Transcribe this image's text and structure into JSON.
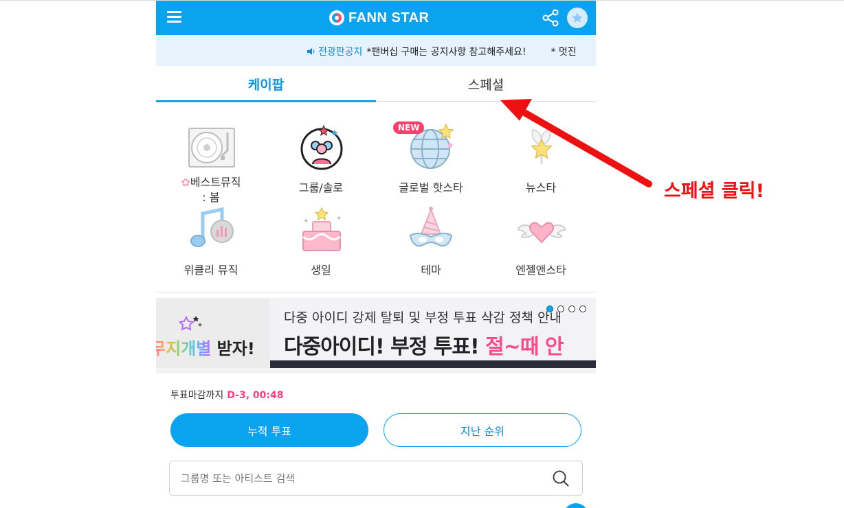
{
  "header": {
    "logo_text": "FANN STAR",
    "brand_color": "#0aa3f0"
  },
  "notice": {
    "label": "전광판공지",
    "text": "*팬버십 구매는 공지사항 참고해주세요!",
    "more": "* 멋진"
  },
  "tabs": [
    {
      "label": "케이팝",
      "active": true
    },
    {
      "label": "스페셜",
      "active": false
    }
  ],
  "categories": [
    {
      "label": "베스트뮤직\n: 봄",
      "icon": "turntable-icon"
    },
    {
      "label": "그룹/솔로",
      "icon": "group-icon"
    },
    {
      "label": "글로벌 핫스타",
      "icon": "globe-icon",
      "badge": "NEW"
    },
    {
      "label": "뉴스타",
      "icon": "sprout-star-icon"
    },
    {
      "label": "위클리 뮤직",
      "icon": "music-note-icon"
    },
    {
      "label": "생일",
      "icon": "cake-icon"
    },
    {
      "label": "테마",
      "icon": "party-mask-icon"
    },
    {
      "label": "엔젤앤스타",
      "icon": "winged-heart-icon"
    }
  ],
  "banner": {
    "left_text_a": "무지개별",
    "left_text_b": " 받자!",
    "line1": "다중 아이디 강제 탈퇴 및 부정 투표 삭감 정책 안내",
    "line2_a": "다중아이디! 부정 투표! ",
    "line2_b": "절~때 안",
    "slide_count": 4,
    "active_slide": 1
  },
  "vote": {
    "deadline_label": "투표마감까지",
    "deadline_value": "D-3, 00:48",
    "cumulative_button": "누적 투표",
    "past_button": "지난 순위"
  },
  "search": {
    "placeholder": "그룹명 또는 아티스트 검색"
  },
  "annotation": {
    "text": "스페셜 클릭!",
    "color": "#ee1111"
  }
}
